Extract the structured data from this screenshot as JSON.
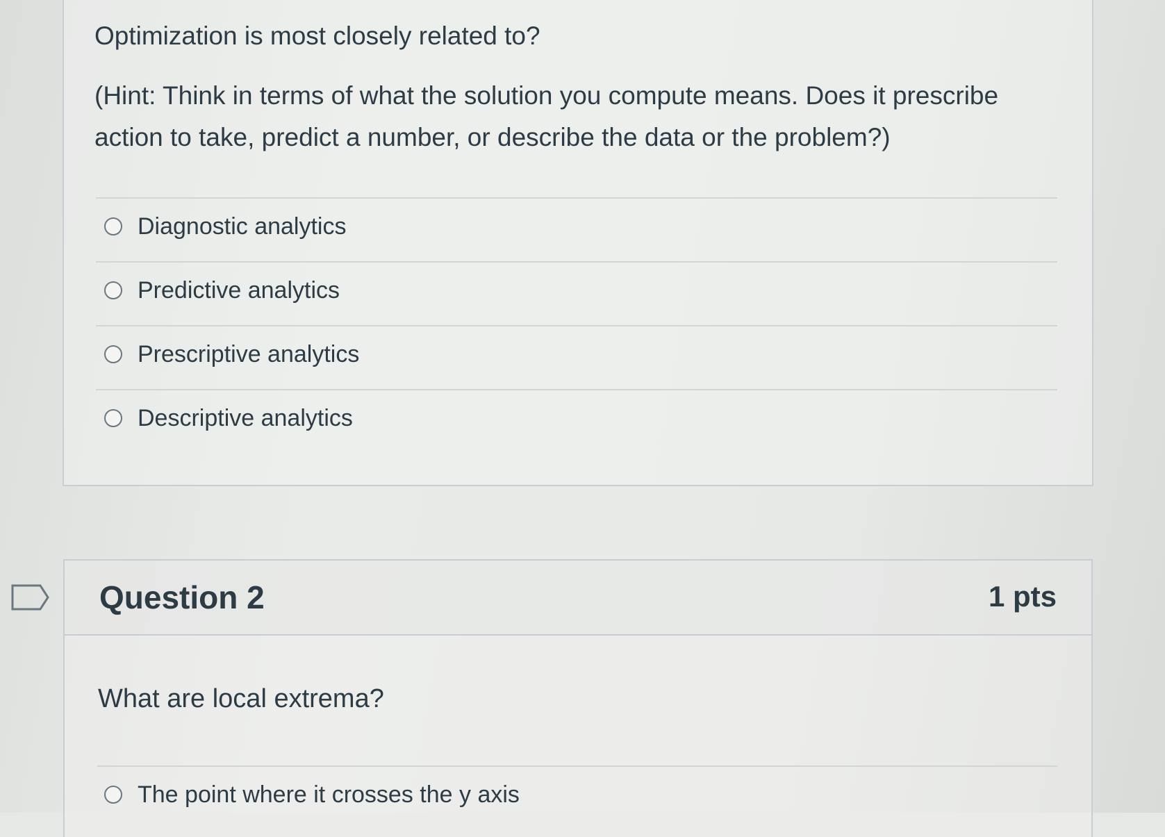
{
  "question1": {
    "text": "Optimization is most closely related to?",
    "hint": "(Hint: Think in terms of what the solution you compute means. Does it prescribe action to take, predict  a number, or describe the data or the problem?)",
    "answers": [
      {
        "label": "Diagnostic analytics",
        "selected": false
      },
      {
        "label": "Predictive analytics",
        "selected": false
      },
      {
        "label": "Prescriptive analytics",
        "selected": false
      },
      {
        "label": "Descriptive analytics",
        "selected": false
      }
    ]
  },
  "question2": {
    "title": "Question 2",
    "points": "1 pts",
    "text": "What are local extrema?",
    "answers": [
      {
        "label": "The point where it crosses the y axis",
        "selected": false
      }
    ]
  },
  "icons": {
    "flag": "flag-question-icon",
    "radio": "radio-button-icon"
  }
}
